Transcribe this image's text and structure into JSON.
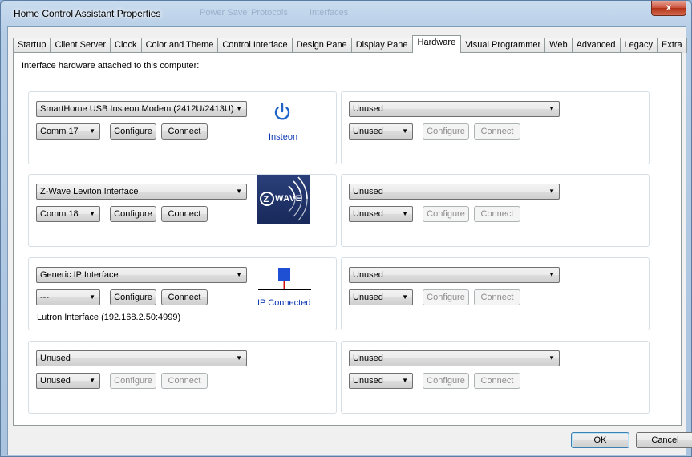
{
  "window": {
    "title": "Home Control Assistant Properties",
    "title_ghost": [
      "Power Save",
      "Protocols",
      "Interfaces"
    ],
    "close_label": "x"
  },
  "tabs": [
    {
      "label": "Startup"
    },
    {
      "label": "Client Server"
    },
    {
      "label": "Clock"
    },
    {
      "label": "Color and Theme"
    },
    {
      "label": "Control Interface"
    },
    {
      "label": "Design Pane"
    },
    {
      "label": "Display Pane"
    },
    {
      "label": "Hardware",
      "active": true
    },
    {
      "label": "Visual Programmer"
    },
    {
      "label": "Web"
    },
    {
      "label": "Advanced"
    },
    {
      "label": "Legacy"
    },
    {
      "label": "Extra"
    }
  ],
  "panel": {
    "intro": "Interface hardware attached to this computer:",
    "slots": [
      {
        "interface": "SmartHome USB Insteon Modem (2412U/2413U)",
        "port": "Comm 17",
        "configure": "Configure",
        "connect": "Connect",
        "enabled": true,
        "badge": {
          "type": "power-icon",
          "label": "Insteon"
        }
      },
      {
        "interface": "Unused",
        "port": "Unused",
        "configure": "Configure",
        "connect": "Connect",
        "enabled": false
      },
      {
        "interface": "Z-Wave Leviton Interface",
        "port": "Comm 18",
        "configure": "Configure",
        "connect": "Connect",
        "enabled": true,
        "badge": {
          "type": "zwave-logo",
          "label": "WAVE"
        }
      },
      {
        "interface": "Unused",
        "port": "Unused",
        "configure": "Configure",
        "connect": "Connect",
        "enabled": false
      },
      {
        "interface": "Generic IP Interface",
        "port": "---",
        "configure": "Configure",
        "connect": "Connect",
        "enabled": true,
        "badge": {
          "type": "network-icon",
          "label": "IP Connected"
        },
        "note": "Lutron Interface (192.168.2.50:4999)"
      },
      {
        "interface": "Unused",
        "port": "Unused",
        "configure": "Configure",
        "connect": "Connect",
        "enabled": false
      },
      {
        "interface": "Unused",
        "port": "Unused",
        "configure": "Configure",
        "connect": "Connect",
        "enabled": false
      },
      {
        "interface": "Unused",
        "port": "Unused",
        "configure": "Configure",
        "connect": "Connect",
        "enabled": false
      }
    ]
  },
  "footer": {
    "ok": "OK",
    "cancel": "Cancel"
  },
  "colors": {
    "accent_blue": "#0b36b4",
    "insteon_blue": "#1e64c8",
    "network_blue": "#1f4fd3",
    "network_red": "#d01010"
  }
}
